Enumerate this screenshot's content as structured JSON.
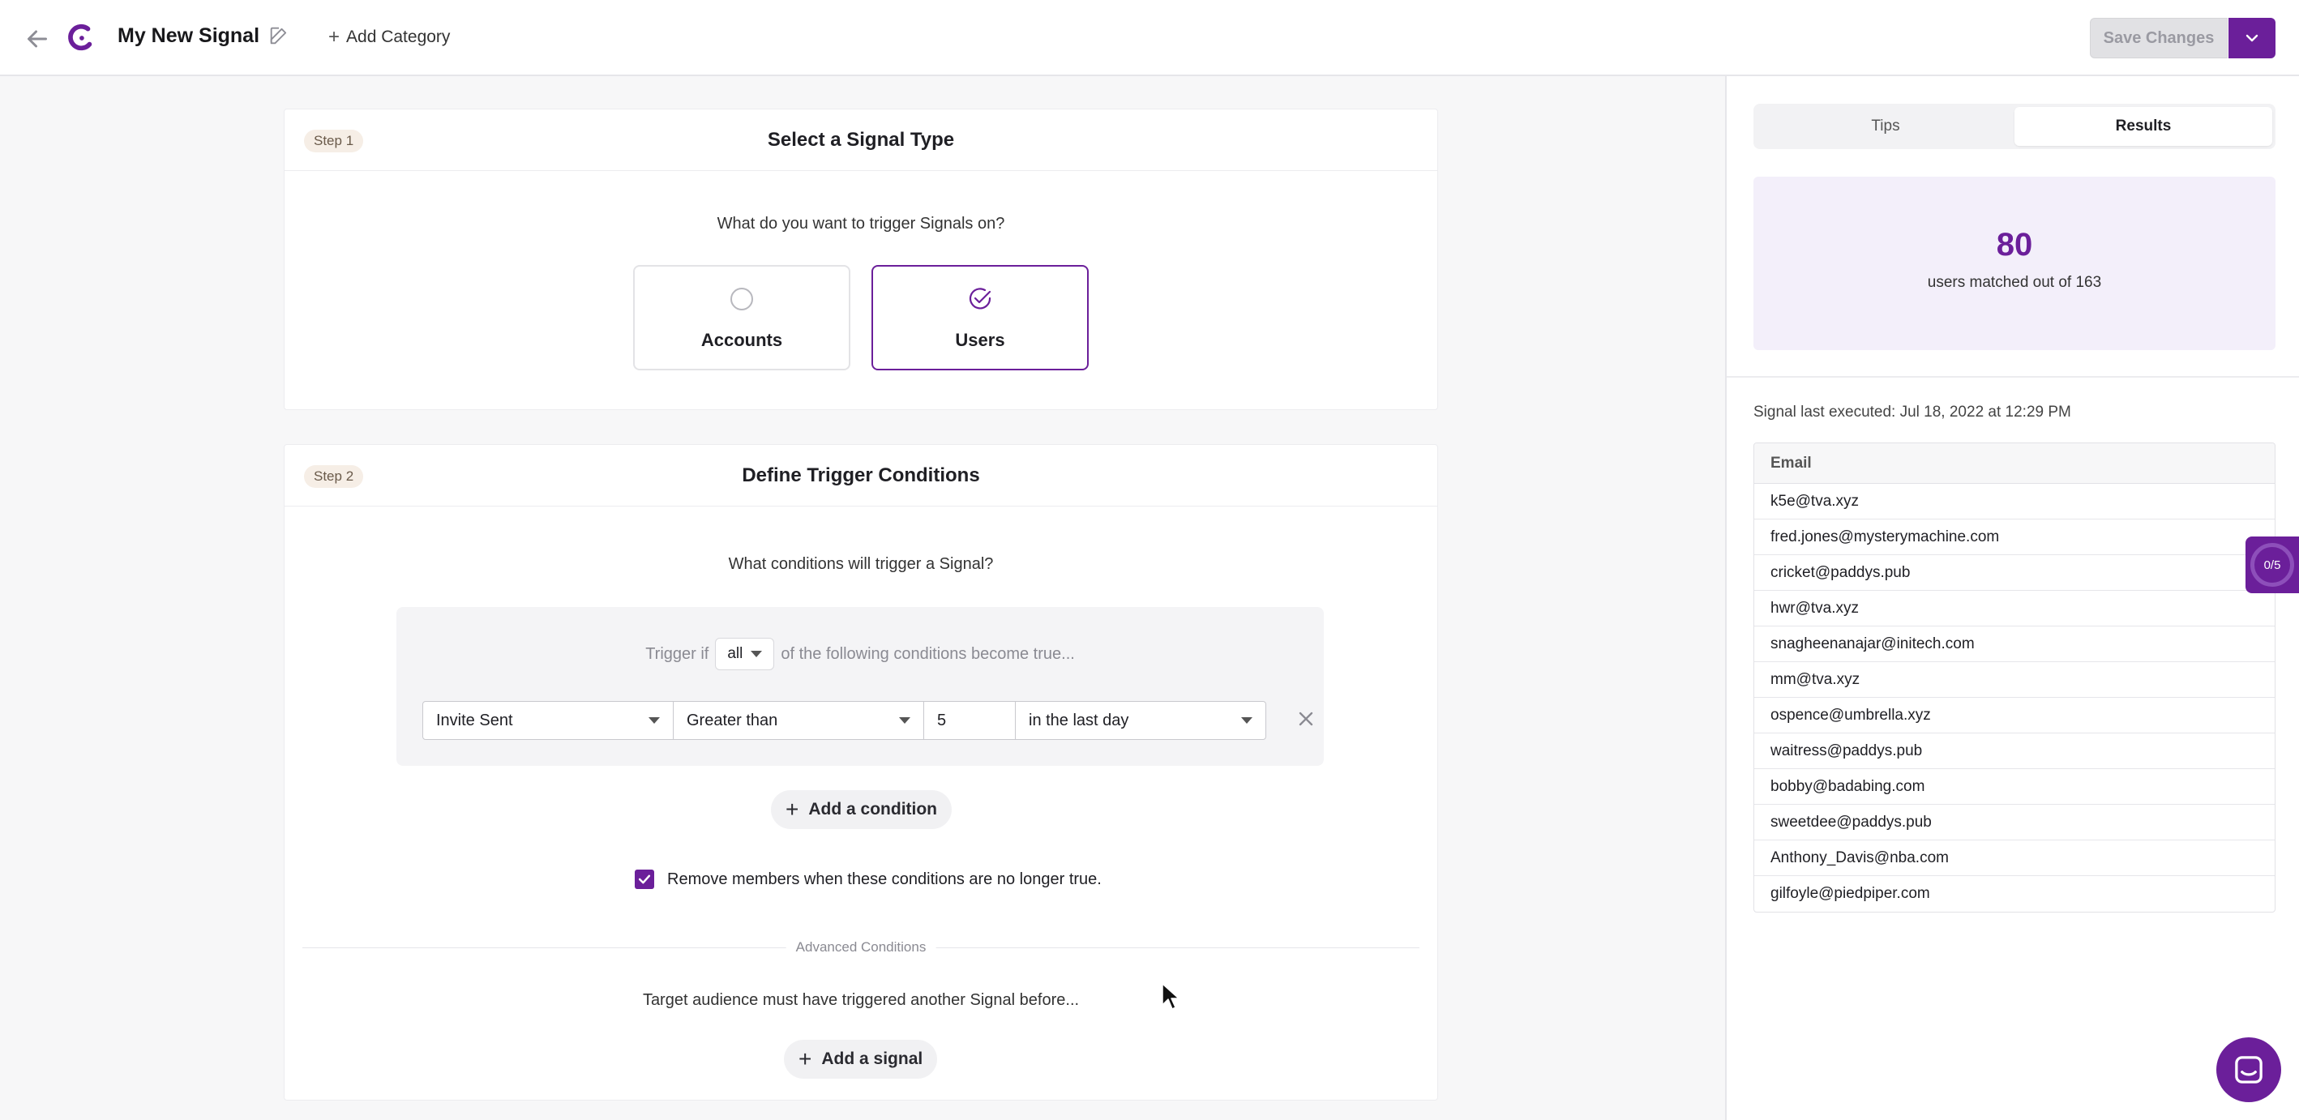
{
  "header": {
    "title": "My New Signal",
    "add_category_label": "Add Category",
    "save_label": "Save Changes"
  },
  "colors": {
    "accent": "#6b1f9a",
    "accent_light": "#f3effa"
  },
  "step1": {
    "badge": "Step 1",
    "title": "Select a Signal Type",
    "question": "What do you want to trigger Signals on?",
    "options": [
      {
        "label": "Accounts",
        "selected": false
      },
      {
        "label": "Users",
        "selected": true
      }
    ]
  },
  "step2": {
    "badge": "Step 2",
    "title": "Define Trigger Conditions",
    "question": "What conditions will trigger a Signal?",
    "trigger_prefix": "Trigger if",
    "trigger_mode": "all",
    "trigger_suffix": "of the following conditions become true...",
    "condition": {
      "event": "Invite Sent",
      "operator": "Greater than",
      "value": "5",
      "timeframe": "in the last day"
    },
    "add_condition_label": "Add a condition",
    "remove_members_label": "Remove members when these conditions are no longer true.",
    "remove_members_checked": true,
    "advanced_label": "Advanced Conditions",
    "advanced_question": "Target audience must have triggered another Signal before...",
    "add_signal_label": "Add a signal"
  },
  "side": {
    "tabs": [
      {
        "label": "Tips",
        "active": false
      },
      {
        "label": "Results",
        "active": true
      }
    ],
    "matched_count": "80",
    "matched_text": "users matched out of 163",
    "last_executed": "Signal last executed: Jul 18, 2022 at 12:29 PM",
    "table_header": "Email",
    "emails": [
      "k5e@tva.xyz",
      "fred.jones@mysterymachine.com",
      "cricket@paddys.pub",
      "hwr@tva.xyz",
      "snagheenanajar@initech.com",
      "mm@tva.xyz",
      "ospence@umbrella.xyz",
      "waitress@paddys.pub",
      "bobby@badabing.com",
      "sweetdee@paddys.pub",
      "Anthony_Davis@nba.com",
      "gilfoyle@piedpiper.com"
    ],
    "progress_badge": "0/5"
  }
}
